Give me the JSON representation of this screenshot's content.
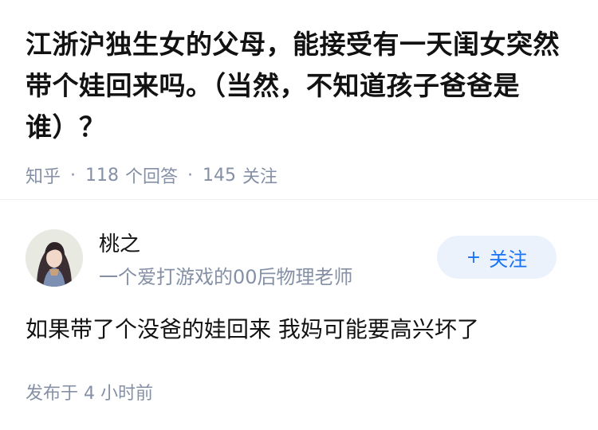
{
  "question": {
    "title": "江浙沪独生女的父母，能接受有一天闺女突然带个娃回来吗。（当然，不知道孩子爸爸是谁）？",
    "meta": {
      "source": "知乎",
      "separator": "·",
      "answer_count": "118",
      "answer_unit": "个回答",
      "follow_count": "145",
      "follow_unit": "关注"
    }
  },
  "author": {
    "avatar_icon": "avatar-image",
    "name": "桃之",
    "bio": "一个爱打游戏的00后物理老师",
    "follow_button": {
      "icon": "plus",
      "label": "关注"
    }
  },
  "answer": {
    "content": "如果带了个没爸的娃回来 我妈可能要高兴坏了",
    "time_prefix": "发布于",
    "time_value": "4 小时前"
  },
  "colors": {
    "title": "#121212",
    "meta": "#8590a6",
    "accent": "#1772f6",
    "button_bg": "#ebf2fc"
  }
}
